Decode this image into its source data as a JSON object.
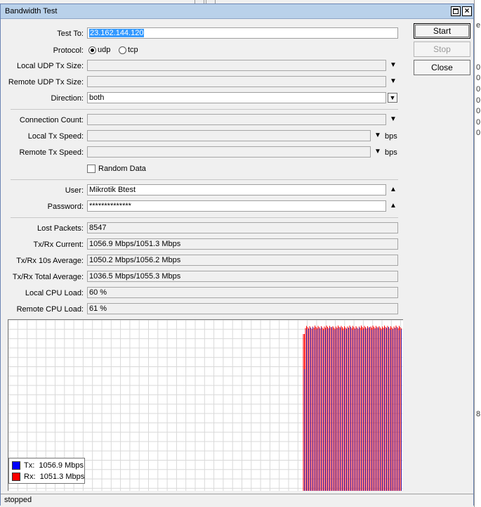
{
  "window": {
    "title": "Bandwidth Test"
  },
  "form": {
    "test_to": {
      "label": "Test To:",
      "value": "23.162.144.120"
    },
    "protocol": {
      "label": "Protocol:",
      "options": [
        "udp",
        "tcp"
      ],
      "selected": "udp"
    },
    "local_udp_tx_size": {
      "label": "Local UDP Tx Size:",
      "value": ""
    },
    "remote_udp_tx_size": {
      "label": "Remote UDP Tx Size:",
      "value": ""
    },
    "direction": {
      "label": "Direction:",
      "value": "both"
    },
    "connection_count": {
      "label": "Connection Count:",
      "value": ""
    },
    "local_tx_speed": {
      "label": "Local Tx Speed:",
      "value": "",
      "unit": "bps"
    },
    "remote_tx_speed": {
      "label": "Remote Tx Speed:",
      "value": "",
      "unit": "bps"
    },
    "random_data": {
      "label": "Random Data",
      "checked": false
    },
    "user": {
      "label": "User:",
      "value": "Mikrotik Btest"
    },
    "password": {
      "label": "Password:",
      "value": "**************"
    }
  },
  "stats": {
    "lost_packets": {
      "label": "Lost Packets:",
      "value": "8547"
    },
    "txrx_current": {
      "label": "Tx/Rx Current:",
      "value": "1056.9 Mbps/1051.3 Mbps"
    },
    "txrx_10s": {
      "label": "Tx/Rx 10s Average:",
      "value": "1050.2 Mbps/1056.2 Mbps"
    },
    "txrx_total": {
      "label": "Tx/Rx Total Average:",
      "value": "1036.5 Mbps/1055.3 Mbps"
    },
    "local_cpu": {
      "label": "Local CPU Load:",
      "value": "60 %"
    },
    "remote_cpu": {
      "label": "Remote CPU Load:",
      "value": "61 %"
    }
  },
  "buttons": {
    "start": "Start",
    "stop": "Stop",
    "close": "Close"
  },
  "legend": {
    "tx": {
      "label": "Tx:",
      "value": "1056.9 Mbps",
      "color": "#0000ff"
    },
    "rx": {
      "label": "Rx:",
      "value": "1051.3 Mbps",
      "color": "#ff0000"
    }
  },
  "status": "stopped"
}
